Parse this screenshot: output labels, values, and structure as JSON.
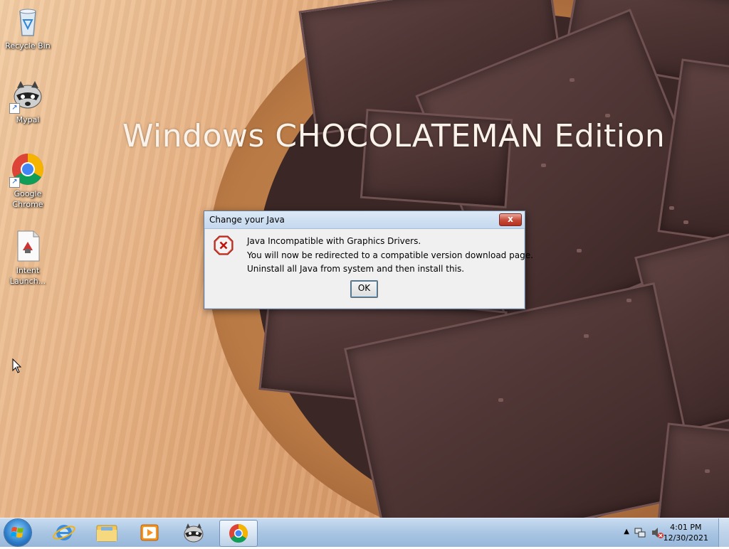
{
  "desktop": {
    "wallpaper_title": "Windows CHOCOLATEMAN Edition",
    "icons": [
      {
        "label": "Recycle Bin",
        "icon": "recycle-bin-icon"
      },
      {
        "label": "Mypal",
        "icon": "raccoon-icon"
      },
      {
        "label": "Google Chrome",
        "icon": "chrome-icon"
      },
      {
        "label": "Intent Launch...",
        "icon": "document-icon"
      }
    ]
  },
  "dialog": {
    "title": "Change your Java",
    "icon": "error-icon",
    "messages": [
      "Java Incompatible with Graphics Drivers.",
      "You will now be redirected to a compatible version download page.",
      "Uninstall all Java from system and then install this."
    ],
    "ok_label": "OK",
    "close_glyph": "x"
  },
  "taskbar": {
    "pinned": [
      "internet-explorer-icon",
      "file-explorer-icon",
      "media-player-icon",
      "mypal-icon",
      "chrome-icon"
    ],
    "active": "chrome-icon",
    "clock": {
      "time": "4:01 PM",
      "date": "12/30/2021"
    },
    "tray_icons": [
      "show-hidden-icons-chevron",
      "network-icon",
      "volume-muted-icon"
    ]
  },
  "colors": {
    "chocolate": "#4b3332",
    "wood": "#b97a45",
    "taskbar": "#a9c5e3",
    "close_button": "#c64a37"
  }
}
